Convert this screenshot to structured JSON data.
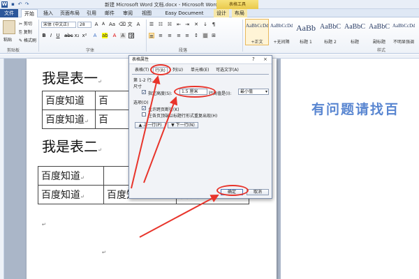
{
  "titlebar": {
    "title": "新建 Microsoft Word 文档.docx - Microsoft Word",
    "context_group": "表格工具",
    "quick_access": [
      "save-icon",
      "undo-icon",
      "redo-icon"
    ]
  },
  "ribbon_tabs": [
    {
      "label": "文件",
      "kind": "file"
    },
    {
      "label": "开始",
      "kind": "active"
    },
    {
      "label": "插入",
      "kind": ""
    },
    {
      "label": "页面布局",
      "kind": ""
    },
    {
      "label": "引用",
      "kind": ""
    },
    {
      "label": "邮件",
      "kind": ""
    },
    {
      "label": "审阅",
      "kind": ""
    },
    {
      "label": "视图",
      "kind": ""
    },
    {
      "label": "Easy Document Creator",
      "kind": ""
    },
    {
      "label": "设计",
      "kind": "ctx"
    },
    {
      "label": "布局",
      "kind": "ctx"
    }
  ],
  "ribbon": {
    "clipboard": {
      "paste": "粘贴",
      "cut": "剪切",
      "copy": "复制",
      "format_painter": "格式刷",
      "group": "剪贴板"
    },
    "font": {
      "name": "宋体 (中文正)",
      "size": "28",
      "group": "字体"
    },
    "paragraph": {
      "group": "段落"
    },
    "styles": {
      "group": "样式",
      "items": [
        {
          "preview": "AaBbCcDd",
          "name": "+正文",
          "selected": true
        },
        {
          "preview": "AaBbCcDd",
          "name": "+无间隔",
          "selected": false
        },
        {
          "preview": "AaBb",
          "name": "标题 1",
          "selected": false
        },
        {
          "preview": "AaBbC",
          "name": "标题 2",
          "selected": false
        },
        {
          "preview": "AaBbC",
          "name": "标题",
          "selected": false
        },
        {
          "preview": "AaBbC",
          "name": "副标题",
          "selected": false
        },
        {
          "preview": "AaBbCcDd",
          "name": "不明显强调",
          "selected": false
        }
      ]
    }
  },
  "document": {
    "table1_heading": "我是表一",
    "table2_heading": "我是表二",
    "cell_text": "百度知道",
    "table1_rows": [
      [
        "百度知道",
        "百"
      ],
      [
        "百度知道",
        "百"
      ]
    ],
    "table2_rows": [
      [
        "百度知道",
        "",
        ""
      ],
      [
        "百度知道",
        "百度知道",
        "百度知道"
      ]
    ],
    "watermark": "有问题请找百",
    "para_mark": "↵"
  },
  "dialog": {
    "title": "表格属性",
    "help": "?",
    "close": "×",
    "tabs": [
      "表格(T)",
      "行(R)",
      "列(U)",
      "单元格(E)",
      "可选文字(A)"
    ],
    "active_tab": 1,
    "row_label": "第 1-2 行:",
    "size_label": "尺寸",
    "specify_height_label": "指定高度(S):",
    "height_value": "1.5 厘米",
    "row_height_is_label": "行高值是(I):",
    "row_height_mode": "最小值",
    "options_label": "选项(O)",
    "allow_break_label": "允许跨页断行(K)",
    "repeat_header_label": "在各页顶端以标题行形式重复出现(H)",
    "prev_row": "上一行(P)",
    "next_row": "下一行(N)",
    "ok": "确定",
    "cancel": "取消",
    "checks": {
      "specify_height": true,
      "allow_break": true,
      "repeat_header": false
    }
  },
  "annotation_color": "#e8342b"
}
